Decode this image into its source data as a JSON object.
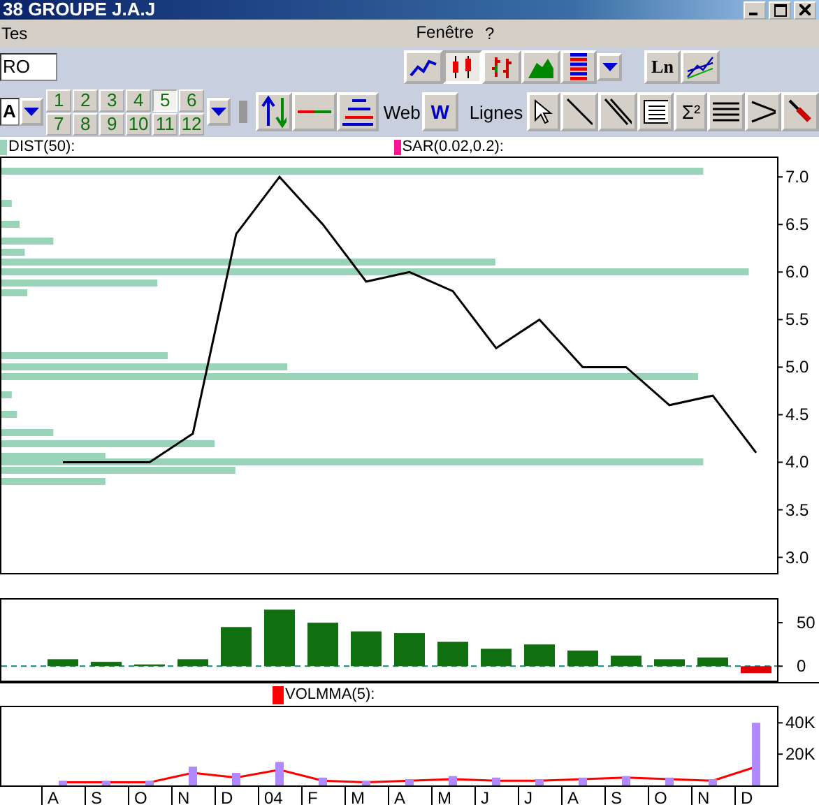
{
  "window": {
    "title": "38  GROUPE J.A.J"
  },
  "menu": [
    {
      "label": "Tes"
    },
    {
      "label": "Fenêtre"
    },
    {
      "label": "?"
    }
  ],
  "toolbar1": {
    "symbol_field": "RO",
    "chart_styles": [
      {
        "kind": "line",
        "selected": false
      },
      {
        "kind": "candle",
        "selected": true
      },
      {
        "kind": "bar",
        "selected": false
      },
      {
        "kind": "area",
        "selected": false
      },
      {
        "kind": "colorbars",
        "selected": false
      }
    ],
    "log_button": "Ln"
  },
  "toolbar2": {
    "field": "A",
    "periods": [
      {
        "label": "1",
        "selected": false
      },
      {
        "label": "2",
        "selected": false
      },
      {
        "label": "3",
        "selected": false
      },
      {
        "label": "4",
        "selected": false
      },
      {
        "label": "5",
        "selected": true
      },
      {
        "label": "6",
        "selected": false
      },
      {
        "label": "7",
        "selected": false
      },
      {
        "label": "8",
        "selected": false
      },
      {
        "label": "9",
        "selected": false
      },
      {
        "label": "10",
        "selected": false
      },
      {
        "label": "11",
        "selected": false
      },
      {
        "label": "12",
        "selected": false
      }
    ],
    "web_label": "Web",
    "web_button": "W",
    "lines_label": "Lignes",
    "tools": [
      {
        "kind": "pointer"
      },
      {
        "kind": "line"
      },
      {
        "kind": "parallel"
      },
      {
        "kind": "text"
      },
      {
        "kind": "sigma",
        "label": "Σ²"
      },
      {
        "kind": "hlines"
      },
      {
        "kind": "angle"
      },
      {
        "kind": "eraser"
      }
    ]
  },
  "main_chart": {
    "legend": [
      {
        "label": "DIST(50):",
        "color": "#99d4b8"
      },
      {
        "label": "SAR(0.02,0.2):",
        "color": "#ff1493"
      }
    ],
    "chart_data": {
      "type": "line",
      "series": [
        {
          "color": "#000000",
          "values": [
            4.0,
            4.0,
            4.0,
            4.3,
            6.4,
            7.0,
            6.5,
            5.9,
            6.0,
            5.8,
            5.2,
            5.5,
            5.0,
            5.0,
            4.6,
            4.7,
            4.1
          ]
        }
      ],
      "ylim": [
        2.85,
        7.2
      ],
      "yticks": [
        {
          "value": 3,
          "label": "3.0"
        },
        3.5,
        {
          "value": 4,
          "label": "4.0"
        },
        4.5,
        {
          "value": 5,
          "label": "5.0"
        },
        5.5,
        {
          "value": 6,
          "label": "6.0"
        },
        6.5,
        {
          "value": 7,
          "label": "7.0"
        }
      ]
    }
  },
  "oscillator": {
    "chart_data": {
      "type": "bar",
      "values": [
        8,
        5,
        2,
        8,
        45,
        65,
        50,
        40,
        38,
        28,
        20,
        25,
        18,
        12,
        8,
        10,
        -8
      ],
      "ylim": [
        -15,
        75
      ],
      "yticks": [
        0,
        50
      ]
    }
  },
  "volume": {
    "chart_data": {
      "type": "bar",
      "categories": [
        "A",
        "S",
        "O",
        "N",
        "D",
        "04",
        "F",
        "M",
        "A",
        "M",
        "J",
        "J",
        "A",
        "S",
        "O",
        "N",
        "D"
      ],
      "stacked": false,
      "series": [
        {
          "type": "bar",
          "color": "#b088ff",
          "values": [
            3,
            3,
            3,
            12,
            8,
            15,
            5,
            3,
            4,
            6,
            5,
            4,
            5,
            6,
            5,
            4,
            40
          ]
        },
        {
          "name": "VOLMMA(5):",
          "type": "line",
          "color": "#ff0000",
          "values": [
            2,
            2,
            2,
            8,
            5,
            10,
            3,
            2,
            3,
            4,
            3,
            3,
            4,
            5,
            4,
            3,
            12
          ]
        }
      ],
      "ylim": [
        0,
        50
      ],
      "yticks": [
        {
          "value": 20,
          "label": "20K"
        },
        {
          "value": 40,
          "label": "40K"
        }
      ]
    }
  }
}
